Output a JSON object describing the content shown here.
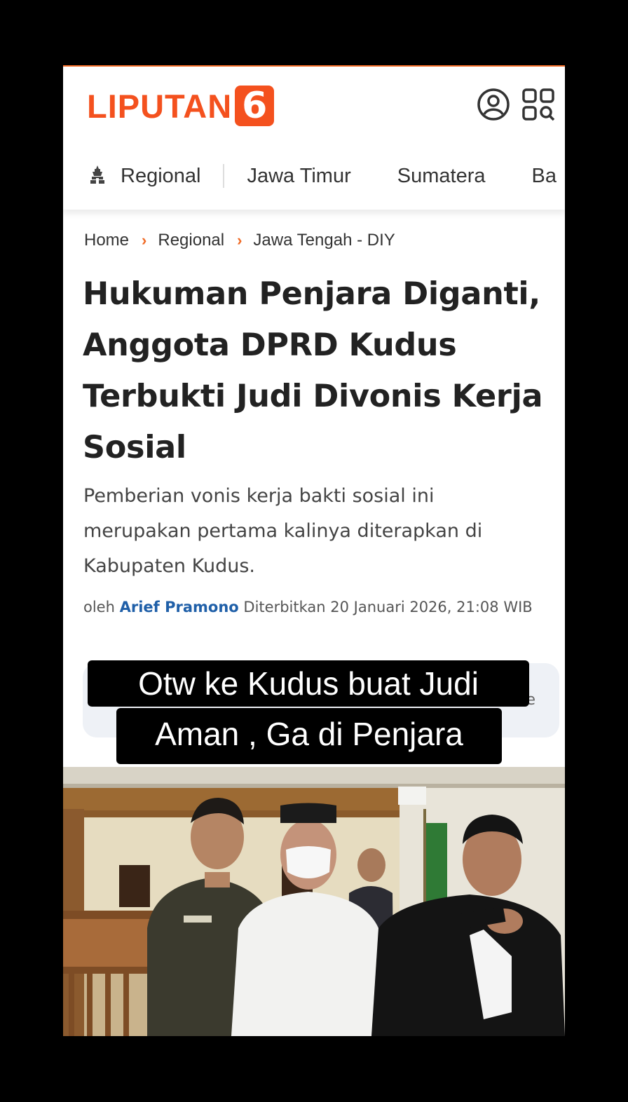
{
  "header": {
    "logo_text": "LIPUTAN",
    "logo_digit": "6",
    "user_icon": "user-circle-icon",
    "menu_icon": "grid-search-icon",
    "accent": "#f4511e"
  },
  "nav": {
    "items": [
      {
        "label": "Regional"
      },
      {
        "label": "Jawa Timur"
      },
      {
        "label": "Sumatera"
      },
      {
        "label": "Ba"
      }
    ],
    "icon": "temple-icon"
  },
  "breadcrumb": {
    "items": [
      "Home",
      "Regional",
      "Jawa Tengah - DIY"
    ],
    "separator": "›"
  },
  "article": {
    "title": "Hukuman Penjara Diganti, Anggota DPRD Kudus Terbukti Judi Divonis Kerja Sosial",
    "summary": "Pemberian vonis kerja bakti sosial ini merupakan pertama kalinya diterapkan di Kabupaten Kudus.",
    "byline_prefix": "oleh",
    "author": "Arief Pramono",
    "published": "Diterbitkan 20 Januari 2026, 21:08 WIB"
  },
  "share_bar": {
    "trailing_char": "e"
  },
  "overlay_caption": {
    "line1": "Otw ke Kudus buat Judi",
    "line2": "Aman , Ga di Penjara"
  }
}
